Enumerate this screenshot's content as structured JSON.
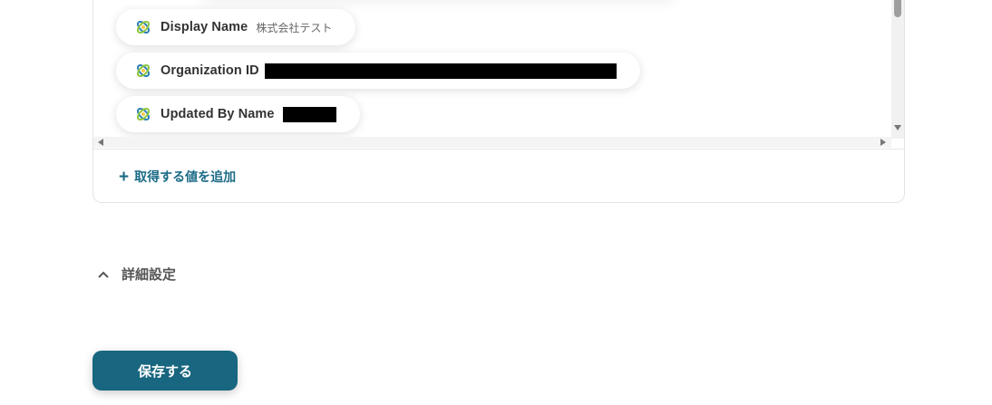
{
  "fields": [
    {
      "label": "Display Name",
      "value": "株式会社テスト",
      "redacted": false
    },
    {
      "label": "Organization ID",
      "value": "",
      "redacted": true
    },
    {
      "label": "Updated By Name",
      "value": "",
      "redacted": true
    }
  ],
  "chip_icon": "app-logo-icon",
  "add_value_label": "取得する値を追加",
  "details_label": "詳細設定",
  "save_label": "保存する",
  "colors": {
    "accent": "#18667f",
    "link": "#1b6b86"
  }
}
